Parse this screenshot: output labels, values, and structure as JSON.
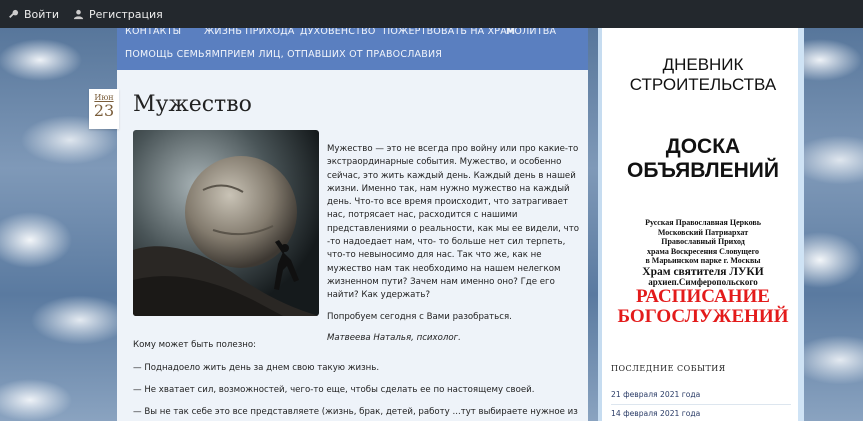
{
  "topbar": {
    "login_label": "Войти",
    "register_label": "Регистрация"
  },
  "nav": {
    "items": [
      "КОНТАКТЫ",
      "ЖИЗНЬ ПРИХОДА",
      "ДУХОВЕНСТВО",
      "ПОЖЕРТВОВАТЬ НА ХРАМ",
      "МОЛИТВА",
      "ПОМОЩЬ СЕМЬЯМ",
      "ПРИЕМ ЛИЦ, ОТПАВШИХ ОТ ПРАВОСЛАВИЯ"
    ]
  },
  "post": {
    "date_month": "Июн",
    "date_day": "23",
    "title": "Мужество",
    "paragraphs": [
      "Мужество — это не всегда про войну или про какие-то экстраординарные события. Мужество, и особенно сейчас, это жить каждый день. Каждый день в нашей жизни. Именно так, нам нужно мужество на каждый день. Что-то все время происходит, что затрагивает нас, потрясает нас, расходится с нашими представлениями о реальности, как мы ее видели, что -то надоедает нам, что- то больше нет сил терпеть, что-то невыносимо для нас. Так что же, как не мужество нам так необходимо на нашем нелегком жизненном пути? Зачем нам именно оно? Где его найти? Как удержать?",
      "Попробуем сегодня с Вами разобраться."
    ],
    "author": "Матвеева Наталья, психолог.",
    "who_helps": "Кому может быть полезно:",
    "bullets": [
      "— Поднадоело жить день за днем свою такую жизнь.",
      "— Не хватает сил, возможностей, чего-то еще, чтобы сделать ее по настоящему своей.",
      "— Вы не так себе это все представляете (жизнь, брак, детей, работу ...тут выбираете нужное из"
    ]
  },
  "sidebar": {
    "banner1": {
      "line1": "ДНЕВНИК",
      "line2": "СТРОИТЕЛЬСТВА"
    },
    "banner2": {
      "line1": "ДОСКА",
      "line2": "ОБЪЯВЛЕНИЙ"
    },
    "banner3": {
      "l1": "Русская Православная Церковь",
      "l2": "Московский Патриархат",
      "l3": "Православный Приход",
      "l4": "храма Воскресения Словущего",
      "l5": "в Марьинском парке  г. Москвы",
      "l6": "Храм святителя ЛУКИ",
      "l7": "архиеп.Симферопольского",
      "l8": "РАСПИСАНИЕ",
      "l9": "БОГОСЛУЖЕНИЙ"
    },
    "events_title": "ПОСЛЕДНИЕ СОБЫТИЯ",
    "events": [
      "21 февраля 2021 года",
      "14 февраля 2021 года"
    ]
  }
}
